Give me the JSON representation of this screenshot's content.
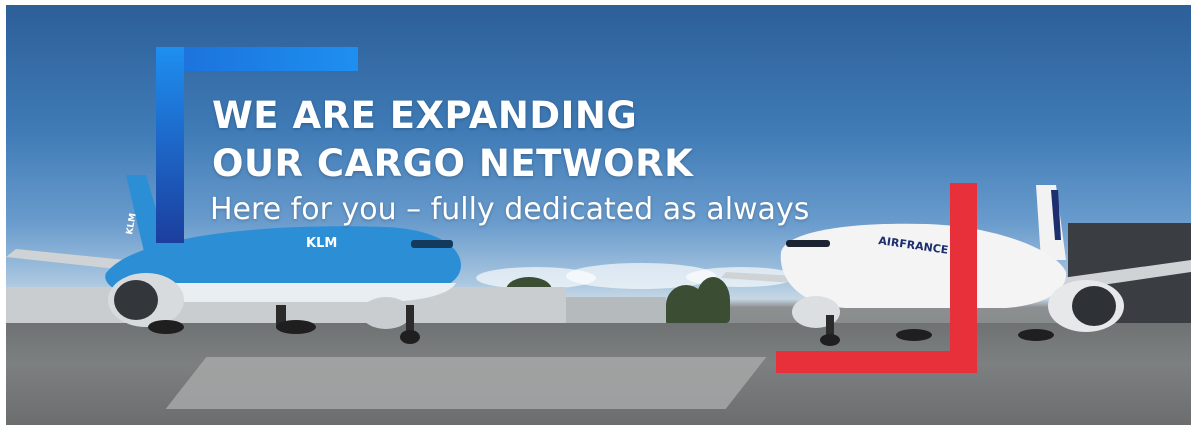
{
  "banner": {
    "headline_line1": "WE ARE EXPANDING",
    "headline_line2": "OUR CARGO NETWORK",
    "subheadline": "Here for you – fully dedicated as always"
  },
  "aircraft": {
    "left": {
      "livery_text": "KLM",
      "tail_text": "KLM",
      "body_color": "#2c8fd6"
    },
    "right": {
      "livery_text": "AIRFRANCE",
      "body_color": "#f4f4f4"
    }
  },
  "colors": {
    "blue_frame": "#1e8ff0",
    "red_frame": "#e8303a",
    "text": "#ffffff"
  }
}
